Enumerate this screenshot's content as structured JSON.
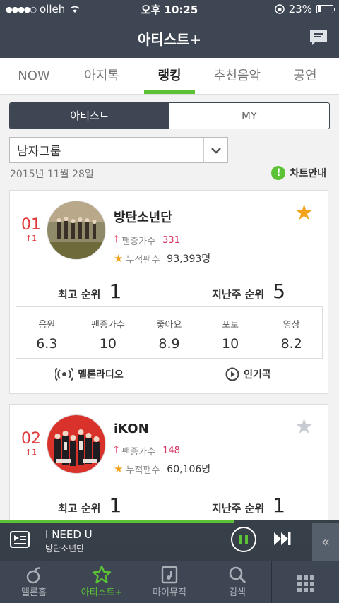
{
  "status": {
    "carrier": "olleh",
    "time": "오후 10:25",
    "battery": "23%",
    "battery_level": 0.23
  },
  "header": {
    "title": "아티스트+"
  },
  "tabs": [
    {
      "label": "NOW"
    },
    {
      "label": "아지톡"
    },
    {
      "label": "랭킹",
      "active": true
    },
    {
      "label": "추천음악"
    },
    {
      "label": "공연"
    }
  ],
  "segment": {
    "left": "아티스트",
    "right": "MY"
  },
  "category": {
    "selected": "남자그룹"
  },
  "date": "2015년 11월 28일",
  "chart_guide": "차트안내",
  "cards": [
    {
      "rank": "01",
      "change": "1",
      "name": "방탄소년단",
      "fan_increase_label": "팬증가수",
      "fan_increase": "331",
      "total_fans_label": "누적팬수",
      "total_fans": "93,393명",
      "favorited": true,
      "best_rank_label": "최고 순위",
      "best_rank": "1",
      "last_week_label": "지난주 순위",
      "last_week": "5",
      "stats": [
        {
          "label": "음원",
          "value": "6.3"
        },
        {
          "label": "팬증가수",
          "value": "10"
        },
        {
          "label": "좋아요",
          "value": "8.9"
        },
        {
          "label": "포토",
          "value": "10"
        },
        {
          "label": "영상",
          "value": "8.2"
        }
      ],
      "radio": "멜론라디오",
      "popular": "인기곡"
    },
    {
      "rank": "02",
      "change": "1",
      "name": "iKON",
      "fan_increase_label": "팬증가수",
      "fan_increase": "148",
      "total_fans_label": "누적팬수",
      "total_fans": "60,106명",
      "favorited": false,
      "best_rank_label": "최고 순위",
      "best_rank": "1",
      "last_week_label": "지난주 순위",
      "last_week": "1"
    }
  ],
  "player": {
    "title": "I NEED U",
    "artist": "방탄소년단",
    "progress": 0.69
  },
  "bottom_nav": [
    {
      "label": "멜론홈",
      "icon": "melon-home-icon"
    },
    {
      "label": "아티스트+",
      "icon": "star-icon",
      "active": true
    },
    {
      "label": "마이뮤직",
      "icon": "my-music-icon"
    },
    {
      "label": "검색",
      "icon": "search-icon"
    },
    {
      "label": "",
      "icon": "grid-menu-icon"
    }
  ],
  "colors": {
    "header": "#3d4652",
    "accent": "#5bc235",
    "rank": "#e03b3b",
    "star": "#f2a31b"
  }
}
